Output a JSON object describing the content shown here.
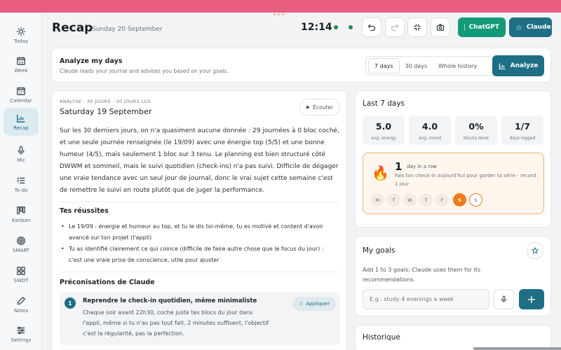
{
  "header": {
    "title": "Recap",
    "date": "Sunday 20 September",
    "clock": "12:14",
    "chatgpt_label": "ChatGPT",
    "claude_label": "Claude"
  },
  "sidebar": {
    "items": [
      {
        "label": "Today",
        "icon": "sun-icon"
      },
      {
        "label": "Week",
        "icon": "calendar-week-icon"
      },
      {
        "label": "Calendar",
        "icon": "calendar-icon"
      },
      {
        "label": "Recap",
        "icon": "chart-icon",
        "active": true
      },
      {
        "label": "Mic",
        "icon": "mic-icon"
      },
      {
        "label": "To-do",
        "icon": "checklist-icon"
      },
      {
        "label": "Kanban",
        "icon": "kanban-icon"
      },
      {
        "label": "SMART",
        "icon": "target-icon"
      },
      {
        "label": "SWOT",
        "icon": "grid-icon"
      },
      {
        "label": "Notes",
        "icon": "pencil-icon"
      },
      {
        "label": "Settings",
        "icon": "sliders-icon"
      }
    ]
  },
  "analyze": {
    "title": "Analyze my days",
    "subtitle": "Claude reads your journal and advises you based on your goals.",
    "ranges": [
      "7 days",
      "30 days",
      "Whole history"
    ],
    "selected_range": "7 days",
    "button": "Analyze"
  },
  "recap": {
    "meta": "ANALYSE · 30 JOURS · 30 JOURS LUS",
    "date": "Saturday 19 September",
    "listen": "Écouter",
    "body": "Sur les 30 derniers jours, on n'a quasiment aucune donnée : 29 journées à 0 bloc coché, et une seule journée renseignée (le 19/09) avec une énergie top (5/5) et une bonne humeur (4/5), mais seulement 1 bloc sur 3 tenu. Le planning est bien structuré côté DWWM et sommeil, mais le suivi quotidien (check-ins) n'a pas suivi. Difficile de dégager une vraie tendance avec un seul jour de journal, donc le vrai sujet cette semaine c'est de remettre le suivi en route plutôt que de juger la performance.",
    "wins_title": "Tes réussites",
    "wins": [
      "Le 19/09 : énergie et humeur au top, et tu le dis toi-même, tu es motivé et content d'avoir avancé sur ton projet (l'appli)",
      "Tu as identifié clairement ce qui coince (difficile de faire autre chose que le focus du jour) : c'est une vraie prise de conscience, utile pour ajuster"
    ],
    "reco_title": "Préconisations de Claude",
    "recommendations": [
      {
        "num": "1",
        "title": "Reprendre le check-in quotidien, même minimaliste",
        "text": "Chaque soir avant 22h30, coche juste tes blocs du jour dans l'appli, même si tu n'as pas tout fait. 2 minutes suffisent, l'objectif c'est la régularité, pas la perfection.",
        "apply": "Appliquer"
      }
    ]
  },
  "stats": {
    "title": "Last 7 days",
    "items": [
      {
        "value": "5.0",
        "label": "avg. energy"
      },
      {
        "value": "4.0",
        "label": "avg. mood"
      },
      {
        "value": "0%",
        "label": "blocks done"
      },
      {
        "value": "1/7",
        "label": "days logged"
      }
    ],
    "streak": {
      "count": "1",
      "unit": "day in a row",
      "text": "Fais ton check-in aujourd'hui pour garder ta série · record : 1 jour",
      "days": [
        {
          "letter": "M",
          "state": "empty"
        },
        {
          "letter": "T",
          "state": "empty"
        },
        {
          "letter": "W",
          "state": "empty"
        },
        {
          "letter": "T",
          "state": "empty"
        },
        {
          "letter": "F",
          "state": "empty"
        },
        {
          "letter": "S",
          "state": "done"
        },
        {
          "letter": "S",
          "state": "today"
        }
      ]
    }
  },
  "goals": {
    "title": "My goals",
    "subtitle": "Add 1 to 3 goals: Claude uses them for its recommendations.",
    "placeholder": "E.g.: study 4 evenings a week"
  },
  "history": {
    "title": "Historique"
  },
  "colors": {
    "accent": "#1e6f86",
    "chatgpt": "#139a78",
    "streak": "#f07a1a",
    "topbar": "#e85e7e"
  }
}
